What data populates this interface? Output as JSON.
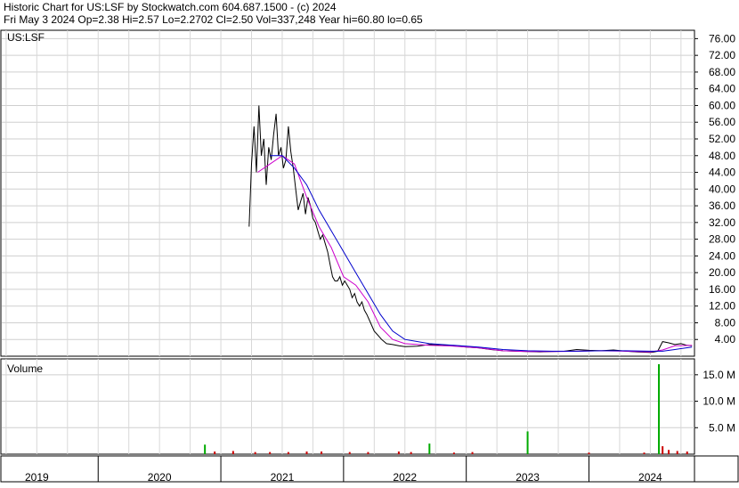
{
  "header": {
    "line1": "Historic Chart for US:LSF by Stockwatch.com 604.687.1500 - (c) 2024",
    "line2": "Fri May  3 2024   Op=2.38   Hi=2.57   Lo=2.2702   Cl=2.50   Vol=337,248   Year hi=60.80   lo=0.65"
  },
  "chart_data": {
    "type": "line",
    "symbol_label": "US:LSF",
    "volume_label": "Volume",
    "price": {
      "ylim": [
        0,
        78
      ],
      "yticks": [
        "76.00",
        "72.00",
        "68.00",
        "64.00",
        "60.00",
        "56.00",
        "52.00",
        "48.00",
        "44.00",
        "40.00",
        "36.00",
        "32.00",
        "28.00",
        "24.00",
        "20.00",
        "16.00",
        "12.00",
        "8.00",
        "4.00"
      ],
      "ytick_values": [
        76,
        72,
        68,
        64,
        60,
        56,
        52,
        48,
        44,
        40,
        36,
        32,
        28,
        24,
        20,
        16,
        12,
        8,
        4
      ],
      "series": [
        {
          "color": "#000000",
          "x": [
            2020.73,
            2020.75,
            2020.77,
            2020.79,
            2020.81,
            2020.83,
            2020.85,
            2020.87,
            2020.89,
            2020.91,
            2020.93,
            2020.95,
            2020.97,
            2020.99,
            2021.01,
            2021.03,
            2021.05,
            2021.07,
            2021.09,
            2021.11,
            2021.13,
            2021.15,
            2021.17,
            2021.19,
            2021.21,
            2021.23,
            2021.25,
            2021.27,
            2021.29,
            2021.31,
            2021.33,
            2021.35,
            2021.37,
            2021.39,
            2021.41,
            2021.43,
            2021.45,
            2021.47,
            2021.49,
            2021.51,
            2021.53,
            2021.55,
            2021.57,
            2021.59,
            2021.61,
            2021.63,
            2021.65,
            2021.67,
            2021.69,
            2021.72,
            2021.75,
            2021.78,
            2021.81,
            2021.85,
            2021.9,
            2021.95,
            2022.0,
            2022.1,
            2022.2,
            2022.3,
            2022.4,
            2022.5,
            2022.6,
            2022.7,
            2022.8,
            2022.9,
            2023.0,
            2023.1,
            2023.2,
            2023.3,
            2023.4,
            2023.5,
            2023.6,
            2023.7,
            2023.8,
            2023.9,
            2024.0,
            2024.02,
            2024.06,
            2024.1,
            2024.15,
            2024.2,
            2024.25,
            2024.3,
            2024.34
          ],
          "y": [
            31,
            46,
            55,
            44,
            60,
            48,
            52,
            41,
            50,
            47,
            53,
            58,
            48,
            50,
            45,
            47,
            55,
            49,
            45,
            40,
            35,
            37,
            39,
            34,
            38,
            36,
            33,
            32,
            30,
            28,
            29,
            27,
            25,
            22,
            19,
            18,
            18,
            19,
            17,
            18,
            17,
            16,
            14,
            15,
            13,
            12,
            13,
            11,
            10,
            8,
            6,
            5,
            4,
            3,
            2.8,
            2.5,
            2.3,
            2.4,
            2.8,
            2.6,
            2.5,
            2.2,
            2.0,
            1.6,
            1.3,
            1.2,
            1.1,
            1.05,
            1.1,
            1.2,
            1.6,
            1.4,
            1.3,
            1.5,
            1.2,
            1.0,
            0.9,
            0.95,
            1.2,
            3.5,
            3.2,
            2.8,
            3.0,
            2.6,
            2.5
          ]
        },
        {
          "color": "#cc00cc",
          "x": [
            2020.8,
            2020.9,
            2021.0,
            2021.1,
            2021.2,
            2021.3,
            2021.4,
            2021.5,
            2021.6,
            2021.7,
            2021.8,
            2021.9,
            2022.0,
            2022.2,
            2022.4,
            2022.6,
            2022.8,
            2023.0,
            2023.2,
            2023.4,
            2023.6,
            2023.8,
            2024.0,
            2024.1,
            2024.2,
            2024.34
          ],
          "y": [
            44,
            46,
            48,
            46,
            38,
            31,
            26,
            19,
            17,
            13,
            7,
            4,
            3.0,
            2.6,
            2.4,
            2.0,
            1.3,
            1.1,
            1.1,
            1.2,
            1.3,
            1.2,
            1.0,
            1.5,
            2.5,
            2.6
          ]
        },
        {
          "color": "#0000cc",
          "x": [
            2020.9,
            2021.0,
            2021.1,
            2021.2,
            2021.3,
            2021.4,
            2021.5,
            2021.6,
            2021.7,
            2021.8,
            2021.9,
            2022.0,
            2022.2,
            2022.4,
            2022.6,
            2022.8,
            2023.0,
            2023.2,
            2023.4,
            2023.6,
            2023.8,
            2024.0,
            2024.1,
            2024.2,
            2024.34
          ],
          "y": [
            48,
            48,
            45,
            41,
            35,
            30,
            25,
            20,
            15,
            10,
            6,
            4,
            3.0,
            2.6,
            2.2,
            1.6,
            1.3,
            1.2,
            1.2,
            1.3,
            1.3,
            1.2,
            1.2,
            1.6,
            2.2
          ]
        }
      ]
    },
    "volume": {
      "ylim": [
        0,
        18
      ],
      "yticks": [
        "15.0 M",
        "10.0 M",
        "5.0 M"
      ],
      "ytick_values": [
        15,
        10,
        5
      ],
      "bars": [
        {
          "x": 2020.37,
          "y": 1.8,
          "color": "#00aa00"
        },
        {
          "x": 2020.45,
          "y": 0.5,
          "color": "#cc0000"
        },
        {
          "x": 2020.6,
          "y": 0.6,
          "color": "#cc0000"
        },
        {
          "x": 2020.78,
          "y": 0.4,
          "color": "#cc0000"
        },
        {
          "x": 2020.9,
          "y": 0.4,
          "color": "#cc0000"
        },
        {
          "x": 2021.05,
          "y": 0.4,
          "color": "#cc0000"
        },
        {
          "x": 2021.2,
          "y": 0.5,
          "color": "#cc0000"
        },
        {
          "x": 2021.32,
          "y": 0.5,
          "color": "#cc0000"
        },
        {
          "x": 2021.55,
          "y": 0.4,
          "color": "#cc0000"
        },
        {
          "x": 2021.7,
          "y": 0.4,
          "color": "#cc0000"
        },
        {
          "x": 2021.95,
          "y": 0.5,
          "color": "#cc0000"
        },
        {
          "x": 2022.05,
          "y": 0.4,
          "color": "#cc0000"
        },
        {
          "x": 2022.2,
          "y": 2.0,
          "color": "#00aa00"
        },
        {
          "x": 2022.4,
          "y": 0.3,
          "color": "#cc0000"
        },
        {
          "x": 2022.55,
          "y": 0.4,
          "color": "#cc0000"
        },
        {
          "x": 2023.0,
          "y": 4.3,
          "color": "#00aa00"
        },
        {
          "x": 2023.5,
          "y": 0.3,
          "color": "#cc0000"
        },
        {
          "x": 2023.95,
          "y": 0.3,
          "color": "#cc0000"
        },
        {
          "x": 2024.07,
          "y": 17.0,
          "color": "#00aa00"
        },
        {
          "x": 2024.1,
          "y": 1.5,
          "color": "#cc0000"
        },
        {
          "x": 2024.15,
          "y": 0.8,
          "color": "#cc0000"
        },
        {
          "x": 2024.22,
          "y": 0.6,
          "color": "#cc0000"
        },
        {
          "x": 2024.3,
          "y": 0.5,
          "color": "#cc0000"
        }
      ]
    },
    "xaxis": {
      "range": [
        2018.7,
        2024.36
      ],
      "year_labels": [
        {
          "label": "2019",
          "x": 2019.0
        },
        {
          "label": "2020",
          "x": 2020.0
        },
        {
          "label": "2021",
          "x": 2021.0
        },
        {
          "label": "2022",
          "x": 2022.0
        },
        {
          "label": "2023",
          "x": 2023.0
        },
        {
          "label": "2024",
          "x": 2024.0
        }
      ],
      "year_boundaries": [
        2019.5,
        2020.5,
        2021.5,
        2022.5,
        2023.5
      ],
      "month_gridlines": [
        2018.75,
        2019.0,
        2019.25,
        2019.5,
        2019.75,
        2020.0,
        2020.25,
        2020.5,
        2020.75,
        2021.0,
        2021.25,
        2021.5,
        2021.75,
        2022.0,
        2022.25,
        2022.5,
        2022.75,
        2023.0,
        2023.25,
        2023.5,
        2023.75,
        2024.0,
        2024.25
      ]
    }
  }
}
